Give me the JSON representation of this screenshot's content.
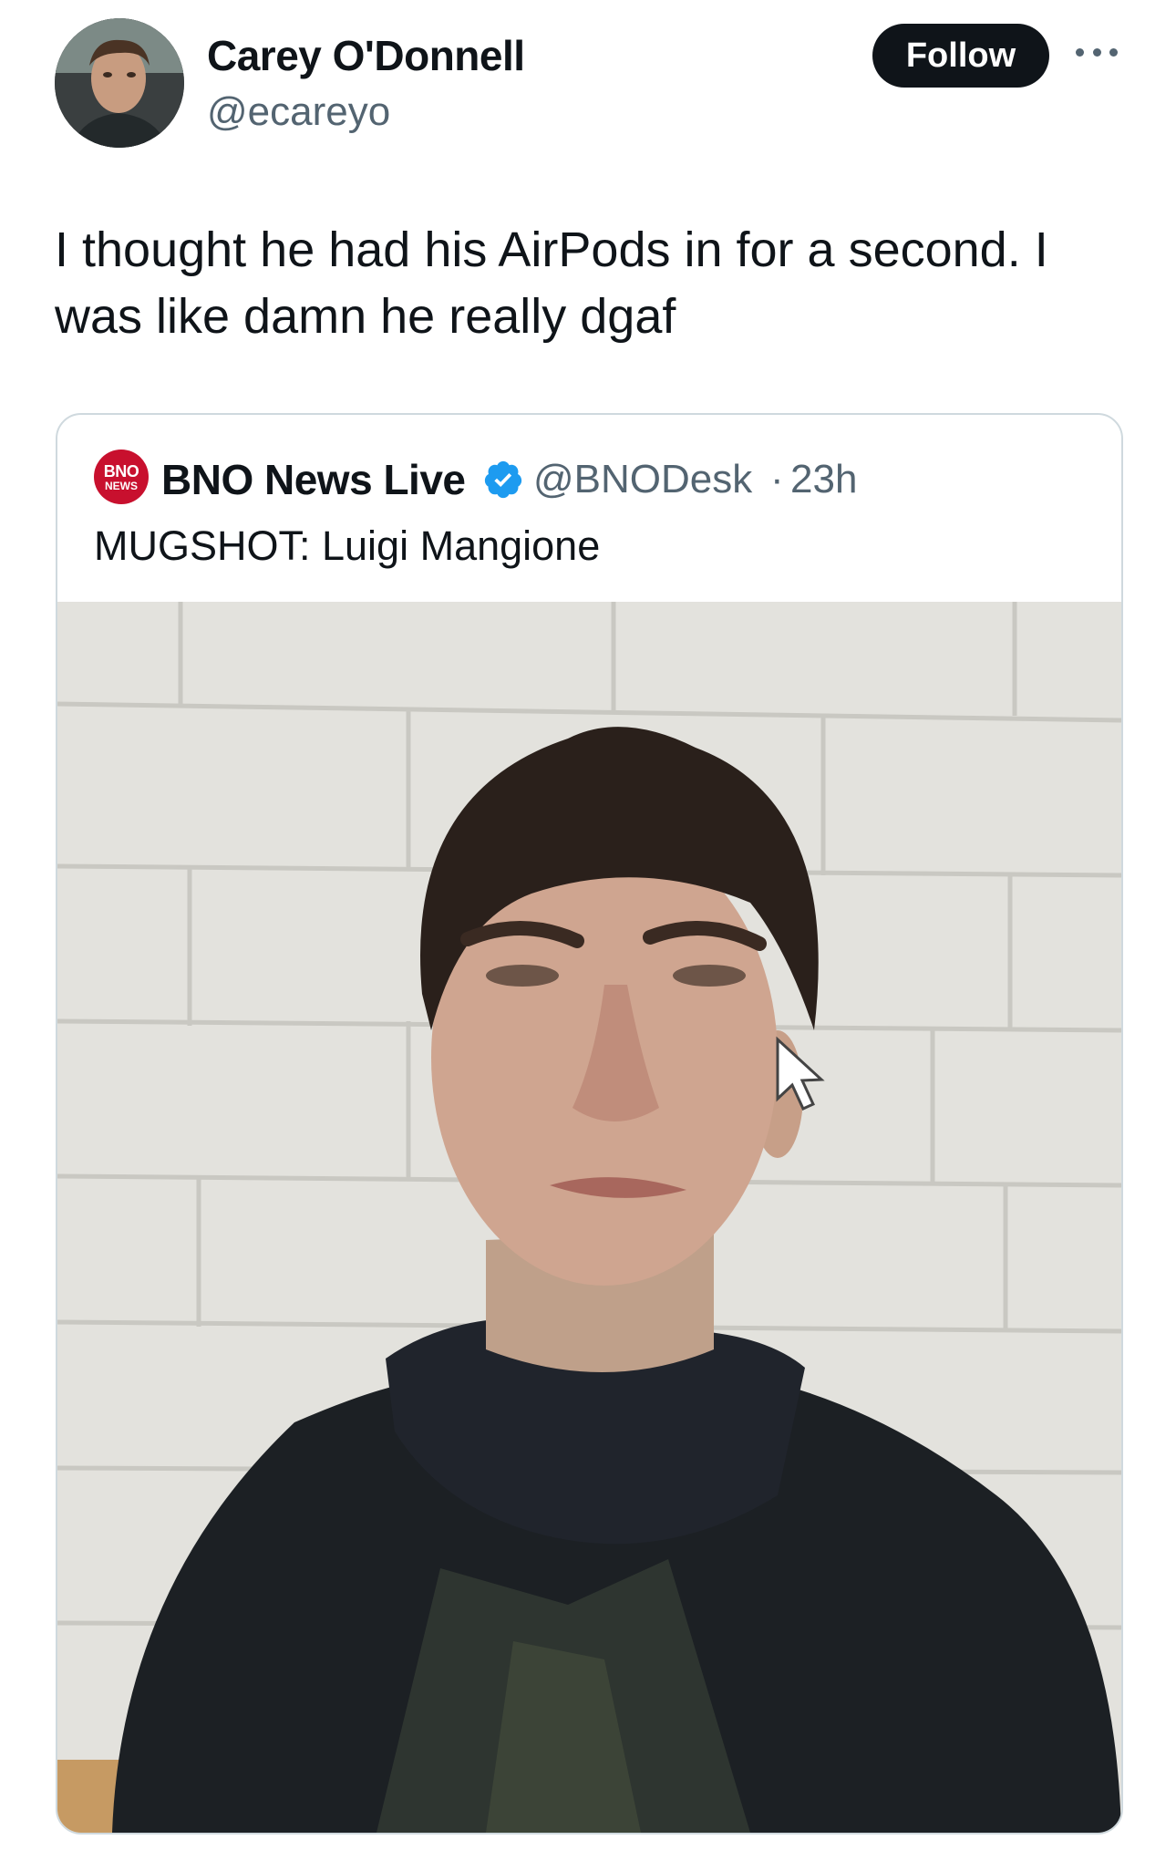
{
  "author": {
    "name": "Carey O'Donnell",
    "handle": "@ecareyo"
  },
  "follow_label": "Follow",
  "tweet_text": "I thought he had his AirPods in for a second. I was like damn he really dgaf",
  "quote": {
    "logo_line1": "BNO",
    "logo_line2": "NEWS",
    "name": "BNO News Live",
    "handle": "@BNODesk",
    "separator": "·",
    "time": "23h",
    "text": "MUGSHOT: Luigi Mangione"
  },
  "icons": {
    "more": "more-icon",
    "verified": "verified-badge-icon",
    "cursor": "mouse-pointer-icon"
  },
  "colors": {
    "text": "#0f1419",
    "secondary": "#536471",
    "verified": "#1d9bf0",
    "follow_bg": "#0f1419",
    "bno_red": "#c8102e"
  }
}
